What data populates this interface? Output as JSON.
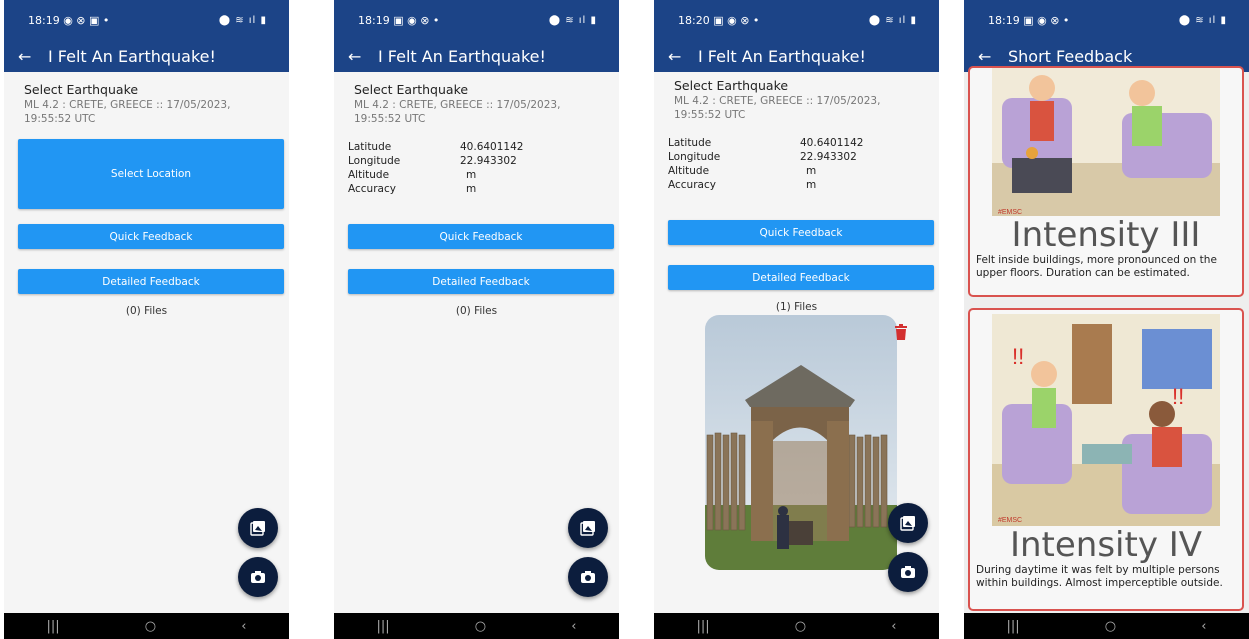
{
  "screens": [
    {
      "status": {
        "time": "18:19",
        "indicators": "◉ ⊗ ▣ •",
        "system_icons": "⬤ ≋ ıl ▮"
      },
      "appbar": {
        "title": "I Felt An Earthquake!"
      },
      "select": {
        "label": "Select Earthquake",
        "event": "ML 4.2 : CRETE, GREECE :: 17/05/2023, 19:55:52 UTC"
      },
      "select_location_label": "Select Location",
      "quick_label": "Quick Feedback",
      "detailed_label": "Detailed Feedback",
      "files_label": "(0) Files"
    },
    {
      "status": {
        "time": "18:19",
        "indicators": "▣ ◉ ⊗ •",
        "system_icons": "⬤ ≋ ıl ▮"
      },
      "appbar": {
        "title": "I Felt An Earthquake!"
      },
      "select": {
        "label": "Select Earthquake",
        "event": "ML 4.2 : CRETE, GREECE :: 17/05/2023, 19:55:52 UTC"
      },
      "location": {
        "latitude_label": "Latitude",
        "latitude": "40.6401142",
        "longitude_label": "Longitude",
        "longitude": "22.943302",
        "altitude_label": "Altitude",
        "altitude": "m",
        "accuracy_label": "Accuracy",
        "accuracy": "m"
      },
      "quick_label": "Quick Feedback",
      "detailed_label": "Detailed Feedback",
      "files_label": "(0) Files"
    },
    {
      "status": {
        "time": "18:20",
        "indicators": "▣ ◉ ⊗ •",
        "system_icons": "⬤ ≋ ıl ▮"
      },
      "appbar": {
        "title": "I Felt An Earthquake!"
      },
      "select": {
        "label": "Select Earthquake",
        "event": "ML 4.2 : CRETE, GREECE :: 17/05/2023, 19:55:52 UTC"
      },
      "location": {
        "latitude_label": "Latitude",
        "latitude": "40.6401142",
        "longitude_label": "Longitude",
        "longitude": "22.943302",
        "altitude_label": "Altitude",
        "altitude": "m",
        "accuracy_label": "Accuracy",
        "accuracy": "m"
      },
      "quick_label": "Quick Feedback",
      "detailed_label": "Detailed Feedback",
      "files_label": "(1) Files"
    },
    {
      "status": {
        "time": "18:19",
        "indicators": "▣ ◉ ⊗ •",
        "system_icons": "⬤ ≋ ıl ▮"
      },
      "appbar": {
        "title": "Short Feedback"
      },
      "cards": [
        {
          "logo": "#EMSC",
          "title": "Intensity III",
          "description": "Felt inside buildings, more pronounced on the upper floors. Duration can be estimated."
        },
        {
          "logo": "#EMSC",
          "title": "Intensity IV",
          "description": "During daytime it was felt by multiple persons within buildings. Almost imperceptible outside."
        }
      ]
    }
  ],
  "colors": {
    "appbar": "#1c4487",
    "button": "#2196f3",
    "fab": "#0c1d3d",
    "card_border": "#d9534f",
    "trash": "#d32f2f"
  },
  "icons": {
    "back": "arrow-left-icon",
    "gallery": "image-gallery-icon",
    "camera": "camera-icon",
    "delete": "trash-icon"
  }
}
